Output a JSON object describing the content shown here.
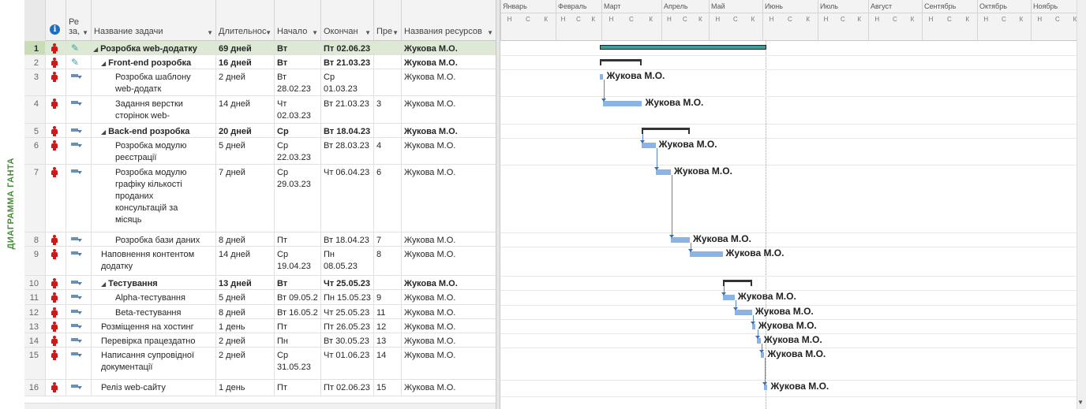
{
  "side_label": "ДИАГРАММА ГАНТА",
  "columns": {
    "info_icon": "i",
    "mode": "Ре за,",
    "name": "Название задачи",
    "duration": "Длительнос",
    "start": "Начало",
    "finish": "Окончан",
    "pred": "Пре",
    "resources": "Названия ресурсов"
  },
  "timeline": {
    "months": [
      "Январь",
      "Февраль",
      "Март",
      "Апрель",
      "Май",
      "Июнь",
      "Июль",
      "Август",
      "Сентябрь",
      "Октябрь",
      "Ноябрь"
    ],
    "thirds": [
      "Н",
      "С",
      "К"
    ]
  },
  "rows": [
    {
      "num": "1",
      "name": "Розробка web-додатку",
      "name2": "",
      "name3": "",
      "name4": "",
      "name5": "",
      "duration": "69 дней",
      "start": "Вт 28.02.2",
      "start2": "",
      "finish": "Пт 02.06.23",
      "finish2": "",
      "pred": "",
      "resource": "Жукова М.О.",
      "summary": true,
      "level": 0,
      "mode": "pin"
    },
    {
      "num": "2",
      "name": "Front-end розробка",
      "name2": "",
      "name3": "",
      "name4": "",
      "name5": "",
      "duration": "16 дней",
      "start": "Вт 28.02.2",
      "start2": "",
      "finish": "Вт 21.03.23",
      "finish2": "",
      "pred": "",
      "resource": "Жукова М.О.",
      "summary": true,
      "level": 1,
      "mode": "pin"
    },
    {
      "num": "3",
      "name": "Розробка шаблону",
      "name2": "web-додатк",
      "name3": "",
      "name4": "",
      "name5": "",
      "duration": "2 дней",
      "start": "Вт",
      "start2": "28.02.23",
      "finish": "Ср",
      "finish2": "01.03.23",
      "pred": "",
      "resource": "Жукова М.О.",
      "summary": false,
      "level": 2,
      "mode": "auto"
    },
    {
      "num": "4",
      "name": "Задання верстки",
      "name2": "сторінок web-",
      "name3": "",
      "name4": "",
      "name5": "",
      "duration": "14 дней",
      "start": "Чт",
      "start2": "02.03.23",
      "finish": "Вт 21.03.23",
      "finish2": "",
      "pred": "3",
      "resource": "Жукова М.О.",
      "summary": false,
      "level": 2,
      "mode": "auto"
    },
    {
      "num": "5",
      "name": "Back-end розробка",
      "name2": "",
      "name3": "",
      "name4": "",
      "name5": "",
      "duration": "20 дней",
      "start": "Ср 22.03.2",
      "start2": "",
      "finish": "Вт 18.04.23",
      "finish2": "",
      "pred": "",
      "resource": "Жукова М.О.",
      "summary": true,
      "level": 1,
      "mode": "auto"
    },
    {
      "num": "6",
      "name": "Розробка модулю",
      "name2": "реєстрації",
      "name3": "",
      "name4": "",
      "name5": "",
      "duration": "5 дней",
      "start": "Ср",
      "start2": "22.03.23",
      "finish": "Вт 28.03.23",
      "finish2": "",
      "pred": "4",
      "resource": "Жукова М.О.",
      "summary": false,
      "level": 2,
      "mode": "auto"
    },
    {
      "num": "7",
      "name": "Розробка модулю",
      "name2": "графіку кількості",
      "name3": "проданих",
      "name4": "консультацій за",
      "name5": "місяць",
      "duration": "7 дней",
      "start": "Ср",
      "start2": "29.03.23",
      "finish": "Чт 06.04.23",
      "finish2": "",
      "pred": "6",
      "resource": "Жукова М.О.",
      "summary": false,
      "level": 2,
      "mode": "auto"
    },
    {
      "num": "8",
      "name": "Розробка бази даних",
      "name2": "",
      "name3": "",
      "name4": "",
      "name5": "",
      "duration": "8 дней",
      "start": "Пт 07.04.2",
      "start2": "",
      "finish": "Вт 18.04.23",
      "finish2": "",
      "pred": "7",
      "resource": "Жукова М.О.",
      "summary": false,
      "level": 2,
      "mode": "auto"
    },
    {
      "num": "9",
      "name": "Наповнення контентом",
      "name2": "додатку",
      "name3": "",
      "name4": "",
      "name5": "",
      "duration": "14 дней",
      "start": "Ср",
      "start2": "19.04.23",
      "finish": "Пн",
      "finish2": "08.05.23",
      "pred": "8",
      "resource": "Жукова М.О.",
      "summary": false,
      "level": 1,
      "mode": "auto"
    },
    {
      "num": "10",
      "name": "Тестування",
      "name2": "",
      "name3": "",
      "name4": "",
      "name5": "",
      "duration": "13 дней",
      "start": "Вт 09.05.2",
      "start2": "",
      "finish": "Чт 25.05.23",
      "finish2": "",
      "pred": "",
      "resource": "Жукова М.О.",
      "summary": true,
      "level": 1,
      "mode": "auto"
    },
    {
      "num": "11",
      "name": "Alpha-тестування",
      "name2": "",
      "name3": "",
      "name4": "",
      "name5": "",
      "duration": "5 дней",
      "start": "Вт 09.05.2",
      "start2": "",
      "finish": "Пн 15.05.23",
      "finish2": "",
      "pred": "9",
      "resource": "Жукова М.О.",
      "summary": false,
      "level": 2,
      "mode": "auto"
    },
    {
      "num": "12",
      "name": "Beta-тестування",
      "name2": "",
      "name3": "",
      "name4": "",
      "name5": "",
      "duration": "8 дней",
      "start": "Вт 16.05.2",
      "start2": "",
      "finish": "Чт 25.05.23",
      "finish2": "",
      "pred": "11",
      "resource": "Жукова М.О.",
      "summary": false,
      "level": 2,
      "mode": "auto"
    },
    {
      "num": "13",
      "name": "Розміщення на хостинг",
      "name2": "",
      "name3": "",
      "name4": "",
      "name5": "",
      "duration": "1 день",
      "start": "Пт 26.05.2",
      "start2": "",
      "finish": "Пт 26.05.23",
      "finish2": "",
      "pred": "12",
      "resource": "Жукова М.О.",
      "summary": false,
      "level": 1,
      "mode": "auto"
    },
    {
      "num": "14",
      "name": "Перевірка працездатно",
      "name2": "",
      "name3": "",
      "name4": "",
      "name5": "",
      "duration": "2 дней",
      "start": "Пн 29.05.2",
      "start2": "",
      "finish": "Вт 30.05.23",
      "finish2": "",
      "pred": "13",
      "resource": "Жукова М.О.",
      "summary": false,
      "level": 1,
      "mode": "auto"
    },
    {
      "num": "15",
      "name": "Написання супровідної",
      "name2": "документації",
      "name3": "",
      "name4": "",
      "name5": "",
      "duration": "2 дней",
      "start": "Ср",
      "start2": "31.05.23",
      "finish": "Чт 01.06.23",
      "finish2": "",
      "pred": "14",
      "resource": "Жукова М.О.",
      "summary": false,
      "level": 1,
      "mode": "auto"
    },
    {
      "num": "16",
      "name": "Реліз web-сайту",
      "name2": "",
      "name3": "",
      "name4": "",
      "name5": "",
      "duration": "1 день",
      "start": "Пт 02.06.2",
      "start2": "",
      "finish": "Пт 02.06.23",
      "finish2": "",
      "pred": "15",
      "resource": "Жукова М.О.",
      "summary": false,
      "level": 1,
      "mode": "auto"
    }
  ],
  "bar_label": "Жукова М.О.",
  "colors": {
    "task_bar": "#8bb4e6",
    "project_bar": "#3a9c9c",
    "side_label": "#4a8a3c",
    "selected_row": "#dde9d4"
  }
}
